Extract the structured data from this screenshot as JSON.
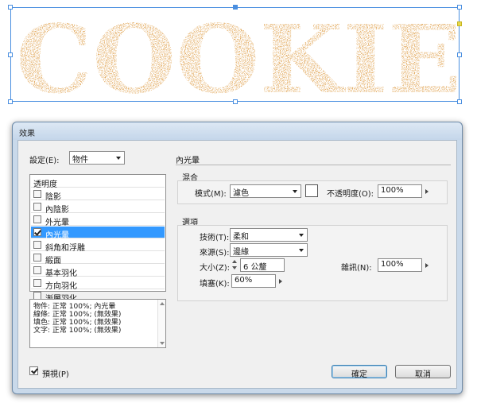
{
  "artwork": {
    "text": "COOKIE",
    "fill_color": "#c4691e",
    "speckle_color": "#8a3a0e"
  },
  "dialog": {
    "title": "效果",
    "settings": {
      "label": "設定(E):",
      "value": "物件"
    },
    "panel_heading": "內光暈",
    "effects": {
      "header": "透明度",
      "items": [
        {
          "label": "陰影",
          "checked": false,
          "selected": false
        },
        {
          "label": "內陰影",
          "checked": false,
          "selected": false
        },
        {
          "label": "外光暈",
          "checked": false,
          "selected": false
        },
        {
          "label": "內光暈",
          "checked": true,
          "selected": true
        },
        {
          "label": "斜角和浮雕",
          "checked": false,
          "selected": false
        },
        {
          "label": "緞面",
          "checked": false,
          "selected": false
        },
        {
          "label": "基本羽化",
          "checked": false,
          "selected": false
        },
        {
          "label": "方向羽化",
          "checked": false,
          "selected": false
        },
        {
          "label": "漸層羽化",
          "checked": false,
          "selected": false
        }
      ]
    },
    "summary": [
      "物件: 正常 100%; 內光暈",
      "線條: 正常 100%; (無效果)",
      "填色: 正常 100%; (無效果)",
      "文字: 正常 100%; (無效果)"
    ],
    "blending": {
      "title": "混合",
      "mode_label": "模式(M):",
      "mode_value": "濾色",
      "swatch_color": "#ffffff",
      "opacity_label": "不透明度(O):",
      "opacity_value": "100%"
    },
    "options": {
      "title": "選項",
      "technique_label": "技術(T):",
      "technique_value": "柔和",
      "source_label": "來源(S):",
      "source_value": "邊緣",
      "size_label": "大小(Z):",
      "size_value": "6 公釐",
      "noise_label": "雜訊(N):",
      "noise_value": "100%",
      "choke_label": "填塞(K):",
      "choke_value": "60%"
    },
    "preview_label": "預視(P)",
    "ok_label": "確定",
    "cancel_label": "取消"
  }
}
